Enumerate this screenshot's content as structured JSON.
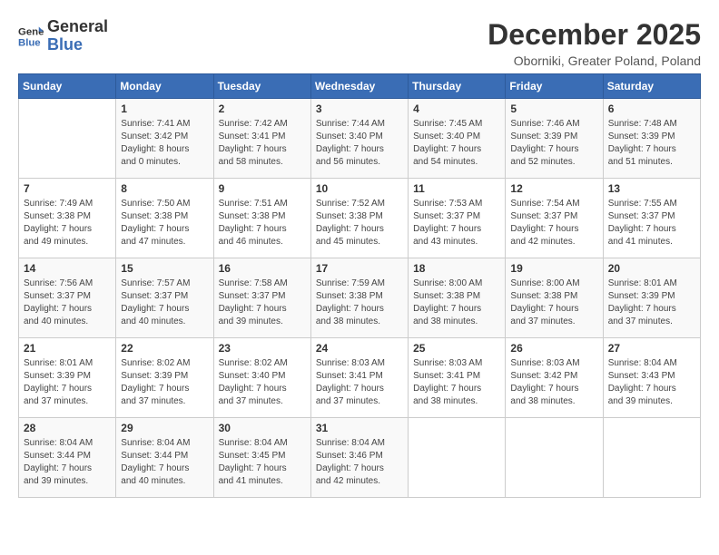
{
  "header": {
    "logo_line1": "General",
    "logo_line2": "Blue",
    "month_title": "December 2025",
    "location": "Oborniki, Greater Poland, Poland"
  },
  "days_of_week": [
    "Sunday",
    "Monday",
    "Tuesday",
    "Wednesday",
    "Thursday",
    "Friday",
    "Saturday"
  ],
  "weeks": [
    [
      {
        "day": "",
        "detail": ""
      },
      {
        "day": "1",
        "detail": "Sunrise: 7:41 AM\nSunset: 3:42 PM\nDaylight: 8 hours\nand 0 minutes."
      },
      {
        "day": "2",
        "detail": "Sunrise: 7:42 AM\nSunset: 3:41 PM\nDaylight: 7 hours\nand 58 minutes."
      },
      {
        "day": "3",
        "detail": "Sunrise: 7:44 AM\nSunset: 3:40 PM\nDaylight: 7 hours\nand 56 minutes."
      },
      {
        "day": "4",
        "detail": "Sunrise: 7:45 AM\nSunset: 3:40 PM\nDaylight: 7 hours\nand 54 minutes."
      },
      {
        "day": "5",
        "detail": "Sunrise: 7:46 AM\nSunset: 3:39 PM\nDaylight: 7 hours\nand 52 minutes."
      },
      {
        "day": "6",
        "detail": "Sunrise: 7:48 AM\nSunset: 3:39 PM\nDaylight: 7 hours\nand 51 minutes."
      }
    ],
    [
      {
        "day": "7",
        "detail": "Sunrise: 7:49 AM\nSunset: 3:38 PM\nDaylight: 7 hours\nand 49 minutes."
      },
      {
        "day": "8",
        "detail": "Sunrise: 7:50 AM\nSunset: 3:38 PM\nDaylight: 7 hours\nand 47 minutes."
      },
      {
        "day": "9",
        "detail": "Sunrise: 7:51 AM\nSunset: 3:38 PM\nDaylight: 7 hours\nand 46 minutes."
      },
      {
        "day": "10",
        "detail": "Sunrise: 7:52 AM\nSunset: 3:38 PM\nDaylight: 7 hours\nand 45 minutes."
      },
      {
        "day": "11",
        "detail": "Sunrise: 7:53 AM\nSunset: 3:37 PM\nDaylight: 7 hours\nand 43 minutes."
      },
      {
        "day": "12",
        "detail": "Sunrise: 7:54 AM\nSunset: 3:37 PM\nDaylight: 7 hours\nand 42 minutes."
      },
      {
        "day": "13",
        "detail": "Sunrise: 7:55 AM\nSunset: 3:37 PM\nDaylight: 7 hours\nand 41 minutes."
      }
    ],
    [
      {
        "day": "14",
        "detail": "Sunrise: 7:56 AM\nSunset: 3:37 PM\nDaylight: 7 hours\nand 40 minutes."
      },
      {
        "day": "15",
        "detail": "Sunrise: 7:57 AM\nSunset: 3:37 PM\nDaylight: 7 hours\nand 40 minutes."
      },
      {
        "day": "16",
        "detail": "Sunrise: 7:58 AM\nSunset: 3:37 PM\nDaylight: 7 hours\nand 39 minutes."
      },
      {
        "day": "17",
        "detail": "Sunrise: 7:59 AM\nSunset: 3:38 PM\nDaylight: 7 hours\nand 38 minutes."
      },
      {
        "day": "18",
        "detail": "Sunrise: 8:00 AM\nSunset: 3:38 PM\nDaylight: 7 hours\nand 38 minutes."
      },
      {
        "day": "19",
        "detail": "Sunrise: 8:00 AM\nSunset: 3:38 PM\nDaylight: 7 hours\nand 37 minutes."
      },
      {
        "day": "20",
        "detail": "Sunrise: 8:01 AM\nSunset: 3:39 PM\nDaylight: 7 hours\nand 37 minutes."
      }
    ],
    [
      {
        "day": "21",
        "detail": "Sunrise: 8:01 AM\nSunset: 3:39 PM\nDaylight: 7 hours\nand 37 minutes."
      },
      {
        "day": "22",
        "detail": "Sunrise: 8:02 AM\nSunset: 3:39 PM\nDaylight: 7 hours\nand 37 minutes."
      },
      {
        "day": "23",
        "detail": "Sunrise: 8:02 AM\nSunset: 3:40 PM\nDaylight: 7 hours\nand 37 minutes."
      },
      {
        "day": "24",
        "detail": "Sunrise: 8:03 AM\nSunset: 3:41 PM\nDaylight: 7 hours\nand 37 minutes."
      },
      {
        "day": "25",
        "detail": "Sunrise: 8:03 AM\nSunset: 3:41 PM\nDaylight: 7 hours\nand 38 minutes."
      },
      {
        "day": "26",
        "detail": "Sunrise: 8:03 AM\nSunset: 3:42 PM\nDaylight: 7 hours\nand 38 minutes."
      },
      {
        "day": "27",
        "detail": "Sunrise: 8:04 AM\nSunset: 3:43 PM\nDaylight: 7 hours\nand 39 minutes."
      }
    ],
    [
      {
        "day": "28",
        "detail": "Sunrise: 8:04 AM\nSunset: 3:44 PM\nDaylight: 7 hours\nand 39 minutes."
      },
      {
        "day": "29",
        "detail": "Sunrise: 8:04 AM\nSunset: 3:44 PM\nDaylight: 7 hours\nand 40 minutes."
      },
      {
        "day": "30",
        "detail": "Sunrise: 8:04 AM\nSunset: 3:45 PM\nDaylight: 7 hours\nand 41 minutes."
      },
      {
        "day": "31",
        "detail": "Sunrise: 8:04 AM\nSunset: 3:46 PM\nDaylight: 7 hours\nand 42 minutes."
      },
      {
        "day": "",
        "detail": ""
      },
      {
        "day": "",
        "detail": ""
      },
      {
        "day": "",
        "detail": ""
      }
    ]
  ]
}
